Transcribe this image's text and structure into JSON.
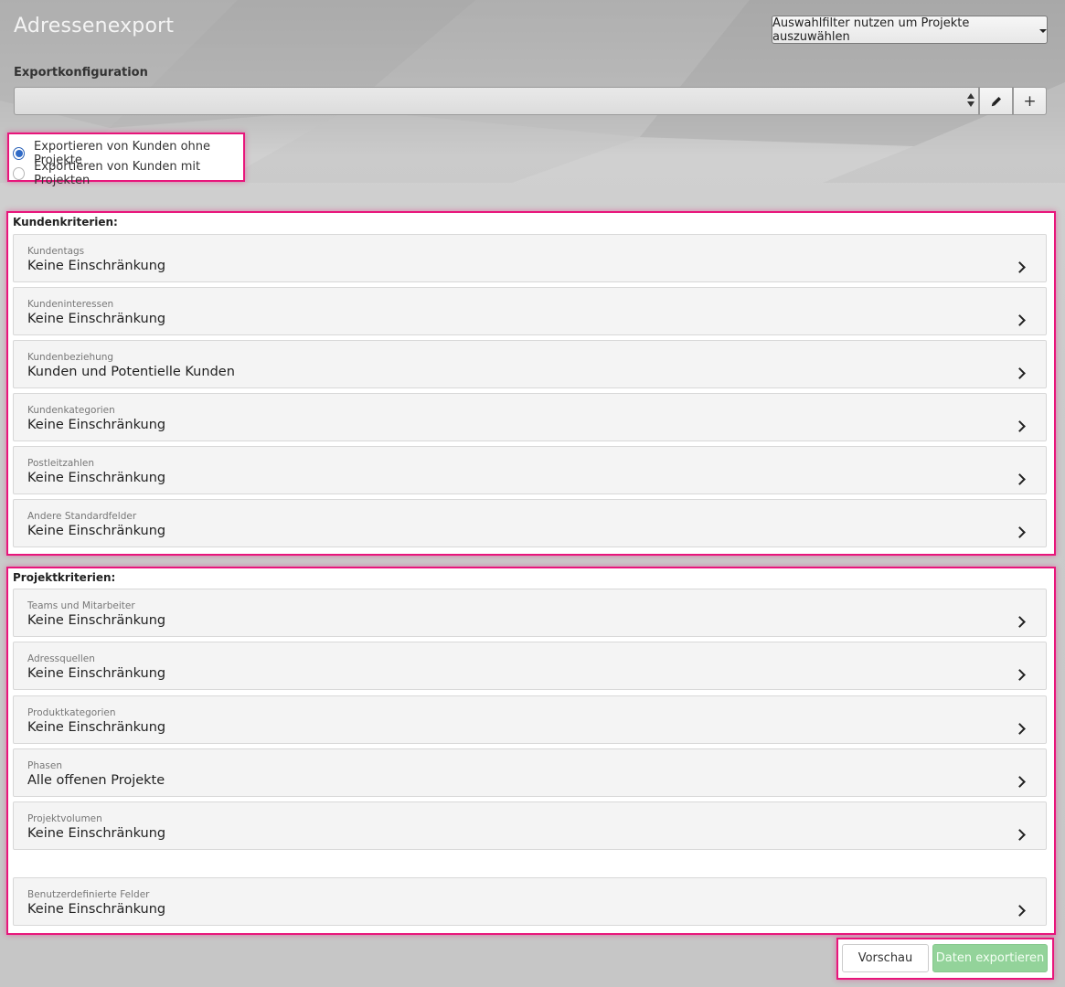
{
  "header": {
    "title": "Adressenexport",
    "filter_button": "Auswahlfilter nutzen um Projekte auszuwählen"
  },
  "config": {
    "label": "Exportkonfiguration",
    "selected_value": "",
    "edit_icon": "pencil-icon",
    "add_label": "+"
  },
  "export_mode": {
    "options": [
      {
        "label": "Exportieren von Kunden ohne Projekte",
        "checked": true
      },
      {
        "label": "Exportieren von Kunden mit Projekten",
        "checked": false
      }
    ]
  },
  "kunden": {
    "title": "Kundenkriterien:",
    "items": [
      {
        "label": "Kundentags",
        "value": "Keine Einschränkung"
      },
      {
        "label": "Kundeninteressen",
        "value": "Keine Einschränkung"
      },
      {
        "label": "Kundenbeziehung",
        "value": "Kunden und Potentielle Kunden"
      },
      {
        "label": "Kundenkategorien",
        "value": "Keine Einschränkung"
      },
      {
        "label": "Postleitzahlen",
        "value": "Keine Einschränkung"
      },
      {
        "label": "Andere Standardfelder",
        "value": "Keine Einschränkung"
      }
    ]
  },
  "projekt": {
    "title": "Projektkriterien:",
    "items": [
      {
        "label": "Teams und Mitarbeiter",
        "value": "Keine Einschränkung"
      },
      {
        "label": "Adressquellen",
        "value": "Keine Einschränkung"
      },
      {
        "label": "Produktkategorien",
        "value": "Keine Einschränkung"
      },
      {
        "label": "Phasen",
        "value": "Alle offenen Projekte"
      },
      {
        "label": "Projektvolumen",
        "value": "Keine Einschränkung"
      },
      {
        "label": "Benutzerdefinierte Felder",
        "value": "Keine Einschränkung"
      }
    ]
  },
  "actions": {
    "preview": "Vorschau",
    "export": "Daten exportieren"
  }
}
